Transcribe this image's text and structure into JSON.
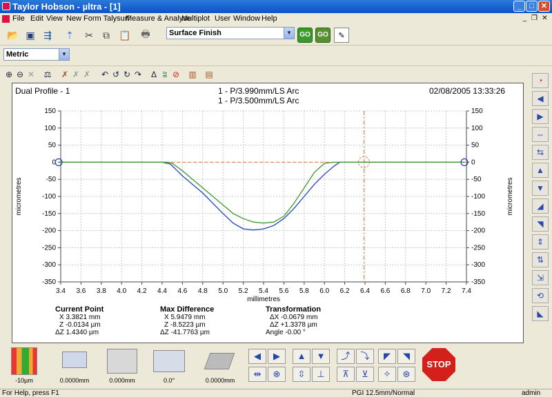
{
  "window": {
    "title": "Taylor Hobson - µltra - [1]",
    "min": "_",
    "max": "□",
    "close": "✕"
  },
  "menu": [
    "File",
    "Edit",
    "View",
    "New Form Talysurf",
    "Measure & Analyse",
    "Multiplot",
    "User",
    "Window",
    "Help"
  ],
  "mdi_controls": {
    "min": "_",
    "restore": "❐",
    "close": "✕"
  },
  "toolbar": {
    "measurement_type": "Surface Finish",
    "go": "GO",
    "go2": "GO"
  },
  "units": {
    "selected": "Metric"
  },
  "plot": {
    "title_left": "Dual Profile - 1",
    "title_line1": "1 - P/3.990mm/LS Arc",
    "title_line2": "1 - P/3.500mm/LS Arc",
    "datetime": "02/08/2005 13:33:26",
    "ylabel": "micrometres",
    "ylabel_right": "micrometres",
    "xlabel": "millimetres"
  },
  "chart_data": {
    "type": "line",
    "xlabel": "millimetres",
    "ylabel": "micrometres",
    "xlim": [
      3.4,
      7.4
    ],
    "ylim": [
      -350,
      150
    ],
    "x_ticks": [
      3.4,
      3.6,
      3.8,
      4.0,
      4.2,
      4.4,
      4.6,
      4.8,
      5.0,
      5.2,
      5.4,
      5.6,
      5.8,
      6.0,
      6.2,
      6.4,
      6.6,
      6.8,
      7.0,
      7.2,
      7.4
    ],
    "y_ticks": [
      150,
      100,
      50,
      0,
      -50,
      -100,
      -150,
      -200,
      -250,
      -300,
      -350
    ],
    "grid": true,
    "series": [
      {
        "color": "#2040c0",
        "x": [
          3.38,
          4.4,
          4.48,
          4.6,
          4.8,
          5.0,
          5.1,
          5.2,
          5.3,
          5.4,
          5.5,
          5.6,
          5.7,
          5.8,
          5.9,
          6.0,
          6.1,
          6.15,
          7.38
        ],
        "y": [
          0,
          0,
          -5,
          -40,
          -90,
          -150,
          -178,
          -195,
          -198,
          -195,
          -185,
          -165,
          -135,
          -100,
          -65,
          -35,
          -10,
          0,
          0
        ]
      },
      {
        "color": "#3a9a2a",
        "x": [
          3.38,
          4.45,
          4.5,
          4.6,
          4.8,
          5.0,
          5.1,
          5.2,
          5.3,
          5.4,
          5.5,
          5.6,
          5.7,
          5.8,
          5.9,
          6.0,
          6.1,
          7.38
        ],
        "y": [
          0,
          0,
          -3,
          -25,
          -75,
          -125,
          -150,
          -165,
          -175,
          -178,
          -175,
          -158,
          -120,
          -75,
          -30,
          -3,
          0,
          0
        ]
      }
    ],
    "cursor": {
      "x": 6.39,
      "y": 0
    }
  },
  "readouts": {
    "current_point": {
      "title": "Current Point",
      "x": "X  3.3821 mm",
      "z": "Z  -0.0134 µm",
      "dz": "ΔZ  1.4340 µm"
    },
    "max_difference": {
      "title": "Max Difference",
      "x": "X  5.9479 mm",
      "z": "Z  -8.5223 µm",
      "dz": "ΔZ  -41.7763 µm"
    },
    "transformation": {
      "title": "Transformation",
      "dx": "ΔX  -0.0679 mm",
      "dz": "ΔZ  +1.3378 µm",
      "angle": "Angle -0.00 °"
    }
  },
  "bottom": {
    "gauge": "-10µm",
    "v1": "0.0000mm",
    "v2": "0.000mm",
    "v3": "0.0°",
    "v4": "0.0000mm",
    "stop": "STOP"
  },
  "status": {
    "help": "For Help, press F1",
    "pgi": "PGI 12.5mm/Normal",
    "user": "admin"
  }
}
